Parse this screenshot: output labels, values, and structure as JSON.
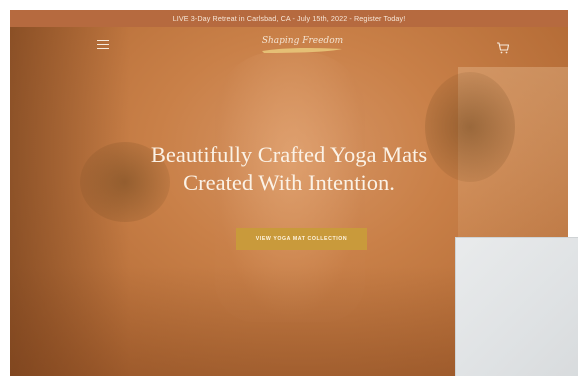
{
  "announcement": {
    "text": "LIVE 3-Day Retreat in Carlsbad, CA - July 15th, 2022 - Register Today!"
  },
  "header": {
    "logo_text": "Shaping Freedom",
    "menu_icon": "hamburger-menu-icon",
    "cart_icon": "shopping-cart-icon"
  },
  "hero": {
    "headline_line1": "Beautifully Crafted Yoga Mats",
    "headline_line2": "Created With Intention.",
    "cta_label": "VIEW YOGA MAT COLLECTION"
  },
  "colors": {
    "announcement_bg": "#b66a3f",
    "hero_tint": "#c98048",
    "cta_bg": "#c99a3b",
    "headline_text": "#fbf2e6"
  }
}
